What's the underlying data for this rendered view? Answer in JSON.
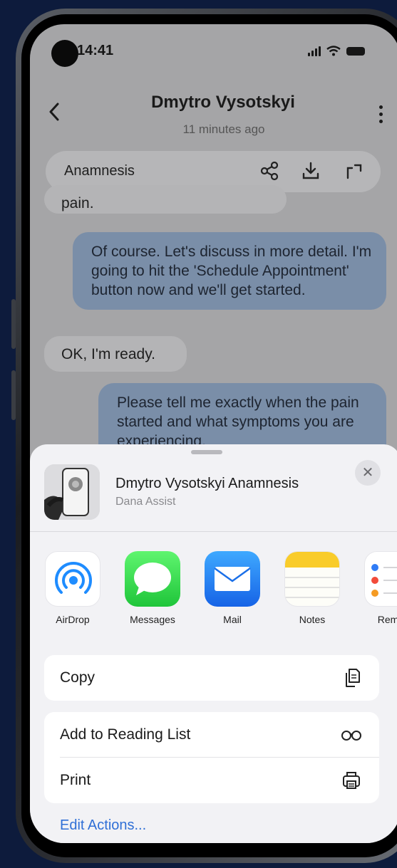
{
  "status_bar": {
    "time": "14:41"
  },
  "header": {
    "title": "Dmytro Vysotskyi",
    "subtitle": "11 minutes ago"
  },
  "tab_bar": {
    "label": "Anamnesis"
  },
  "messages": [
    {
      "side": "in",
      "text": "pain."
    },
    {
      "side": "out",
      "text": "Of course. Let's discuss in more detail. I'm going to hit the 'Schedule Appointment' button now and we'll get started."
    },
    {
      "side": "in",
      "text": "OK, I'm ready."
    },
    {
      "side": "out",
      "text": "Please tell me exactly when the pain started and what symptoms you are experiencing."
    }
  ],
  "share_sheet": {
    "title": "Dmytro Vysotskyi Anamnesis",
    "subtitle": "Dana Assist",
    "apps": [
      {
        "label": "AirDrop",
        "icon": "airdrop-icon"
      },
      {
        "label": "Messages",
        "icon": "messages-icon"
      },
      {
        "label": "Mail",
        "icon": "mail-icon"
      },
      {
        "label": "Notes",
        "icon": "notes-icon"
      },
      {
        "label": "Remin",
        "icon": "reminders-icon"
      }
    ],
    "actions": {
      "copy": "Copy",
      "reading_list": "Add to Reading List",
      "print": "Print"
    },
    "edit_actions": "Edit Actions..."
  },
  "colors": {
    "background": "#0d1b3c",
    "outgoing_bubble": "#7a8ea8",
    "link": "#2f6fd6"
  }
}
